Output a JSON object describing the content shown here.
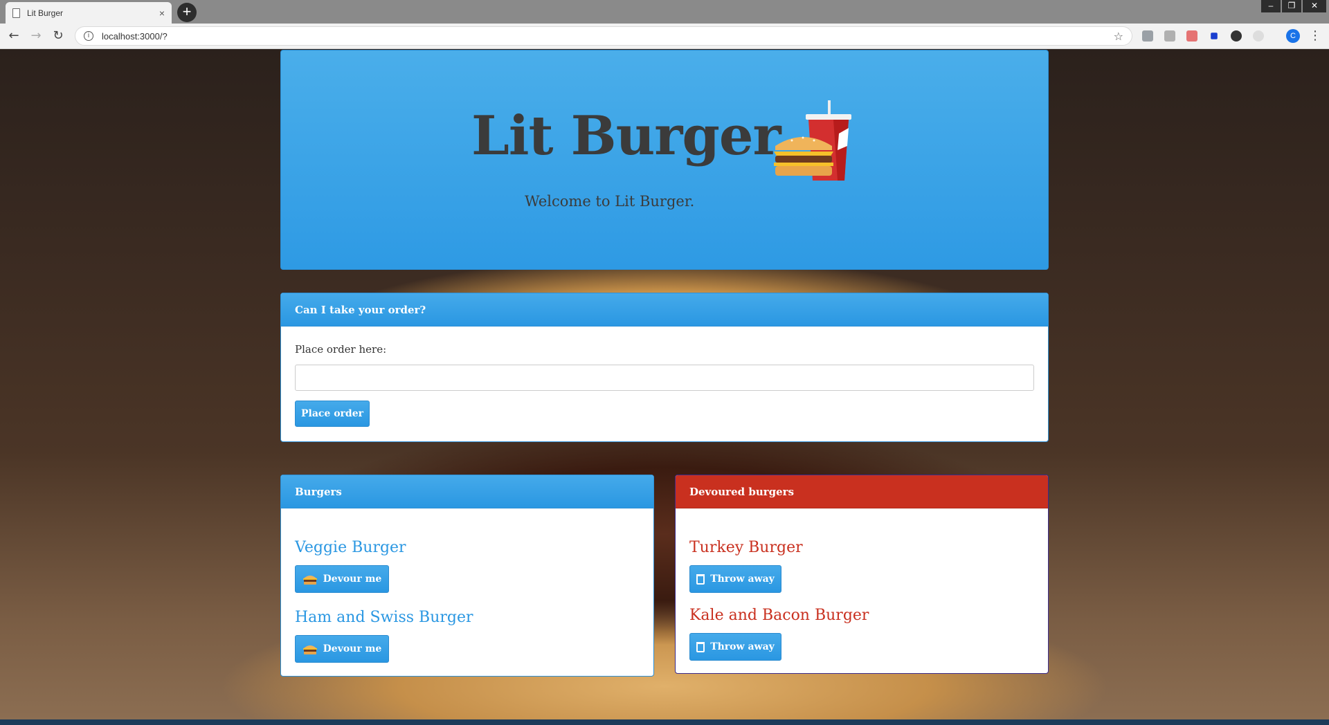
{
  "browser": {
    "tab_title": "Lit Burger",
    "tab_close": "×",
    "new_tab": "+",
    "url": "localhost:3000/?",
    "window_controls": [
      "–",
      "❐",
      "✕"
    ],
    "profile_letter": "C"
  },
  "header": {
    "title": "Lit Burger",
    "subtitle": "Welcome to Lit Burger."
  },
  "order": {
    "heading": "Can I take your order?",
    "label": "Place order here:",
    "input_value": "",
    "button_label": "Place order"
  },
  "burgers": {
    "heading": "Burgers",
    "button_label": "Devour me",
    "items": [
      {
        "name": "Veggie Burger"
      },
      {
        "name": "Ham and Swiss Burger"
      }
    ]
  },
  "devoured": {
    "heading": "Devoured burgers",
    "button_label": "Throw away",
    "items": [
      {
        "name": "Turkey Burger"
      },
      {
        "name": "Kale and Bacon Burger"
      }
    ]
  },
  "colors": {
    "primary": "#2e9ae4",
    "danger": "#c9301f",
    "title_text": "#3b3b3b"
  }
}
